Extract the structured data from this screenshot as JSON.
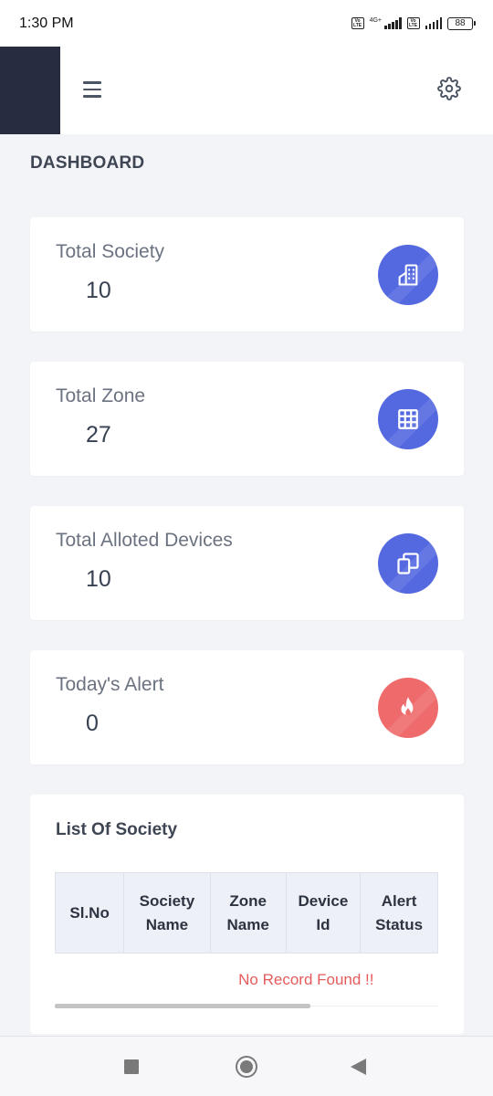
{
  "status_bar": {
    "time": "1:30 PM",
    "volte_1": "Vo LTE",
    "net_type": "4G+",
    "volte_2": "Vo LTE",
    "battery": "88"
  },
  "header": {
    "menu_icon": "hamburger-menu-icon",
    "settings_icon": "gear-icon"
  },
  "page": {
    "title": "DASHBOARD"
  },
  "stats": [
    {
      "label": "Total Society",
      "value": "10",
      "icon": "building-icon",
      "color": "#5468e0"
    },
    {
      "label": "Total Zone",
      "value": "27",
      "icon": "grid-icon",
      "color": "#5468e0"
    },
    {
      "label": "Total Alloted Devices",
      "value": "10",
      "icon": "devices-icon",
      "color": "#5468e0"
    },
    {
      "label": "Today's Alert",
      "value": "0",
      "icon": "fire-icon",
      "color": "#ef6b6b"
    }
  ],
  "society_list": {
    "title": "List Of Society",
    "columns": [
      "Sl.No",
      "Society Name",
      "Zone Name",
      "Device Id",
      "Alert Status"
    ],
    "empty_message": "No Record Found !!"
  },
  "nav": {
    "recents_icon": "square-icon",
    "home_icon": "circle-home-icon",
    "back_icon": "triangle-back-icon"
  }
}
